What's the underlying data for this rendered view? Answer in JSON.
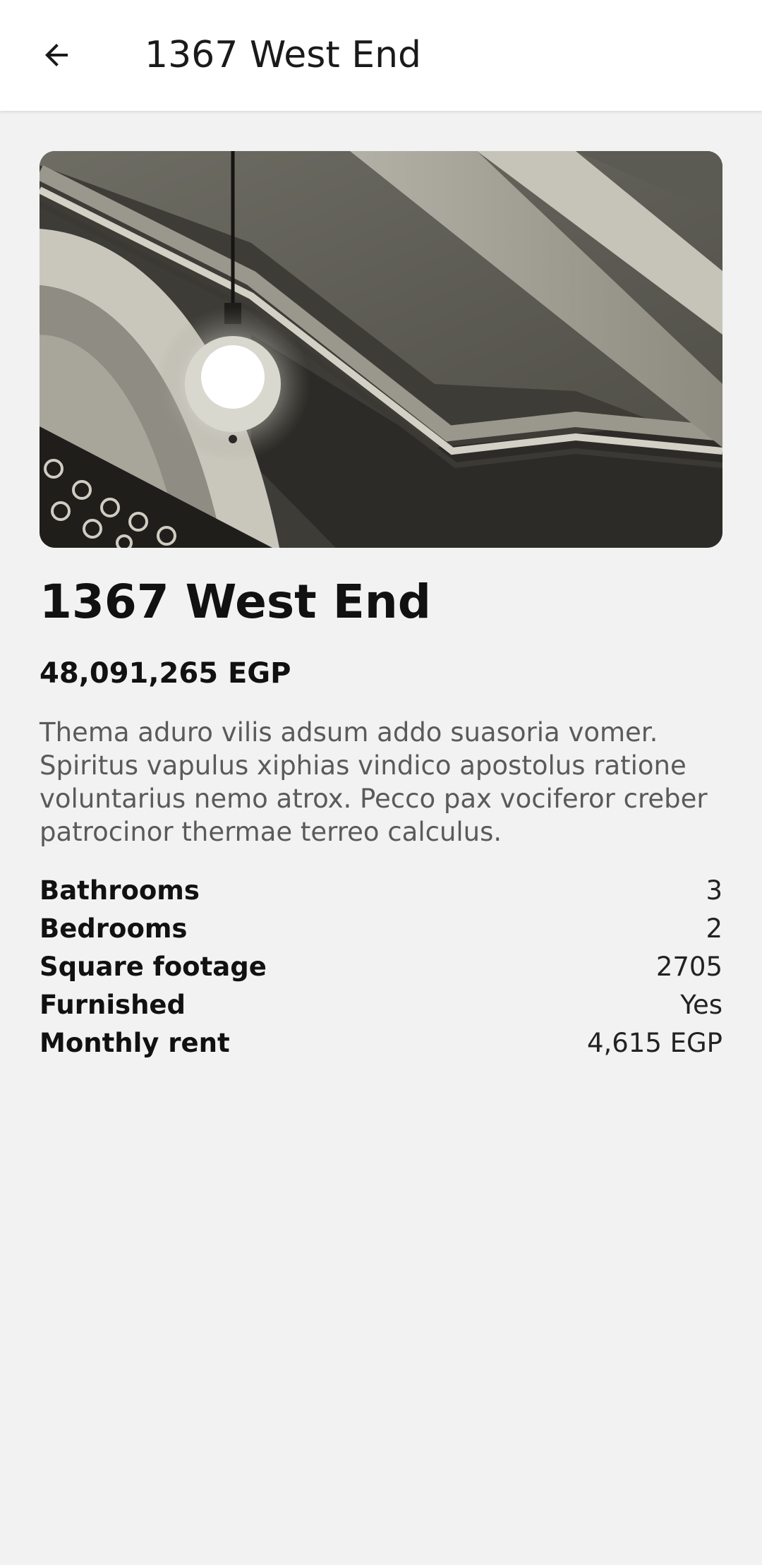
{
  "app_bar": {
    "title": "1367 West End",
    "back_icon": "arrow-left-icon"
  },
  "listing": {
    "title": "1367 West End",
    "price": "48,091,265 EGP",
    "description": "Thema aduro vilis adsum addo suasoria vomer. Spiritus vapulus xiphias vindico apostolus ratione voluntarius nemo atrox. Pecco pax vociferor creber patrocinor thermae terreo calculus.",
    "facts": [
      {
        "label": "Bathrooms",
        "value": "3"
      },
      {
        "label": "Bedrooms",
        "value": "2"
      },
      {
        "label": "Square footage",
        "value": "2705"
      },
      {
        "label": "Furnished",
        "value": "Yes"
      },
      {
        "label": "Monthly rent",
        "value": "4,615 EGP"
      }
    ]
  },
  "colors": {
    "background": "#f2f2f2",
    "app_bar": "#ffffff",
    "text_primary": "#111111",
    "text_secondary": "#5a5a5a"
  }
}
